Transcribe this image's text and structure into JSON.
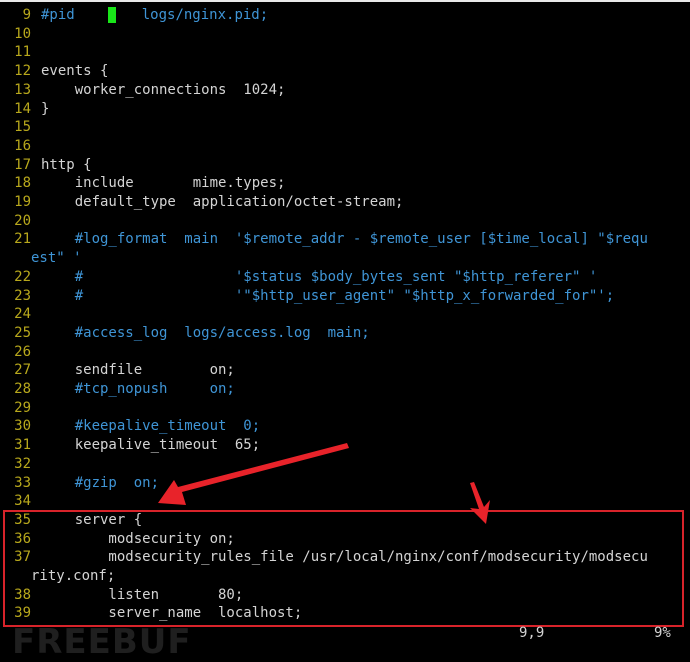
{
  "editor": {
    "rows": [
      {
        "num": "9",
        "segments": [
          {
            "t": "#pid    ",
            "c": "comment"
          },
          {
            "cursor": true
          },
          {
            "t": "   logs/nginx.pid;",
            "c": "comment"
          }
        ]
      },
      {
        "num": "10",
        "segments": []
      },
      {
        "num": "11",
        "segments": []
      },
      {
        "num": "12",
        "segments": [
          {
            "t": "events {"
          }
        ]
      },
      {
        "num": "13",
        "segments": [
          {
            "t": "    worker_connections  1024;"
          }
        ]
      },
      {
        "num": "14",
        "segments": [
          {
            "t": "}"
          }
        ]
      },
      {
        "num": "15",
        "segments": []
      },
      {
        "num": "16",
        "segments": []
      },
      {
        "num": "17",
        "segments": [
          {
            "t": "http {"
          }
        ]
      },
      {
        "num": "18",
        "segments": [
          {
            "t": "    include       mime.types;"
          }
        ]
      },
      {
        "num": "19",
        "segments": [
          {
            "t": "    default_type  application/octet-stream;"
          }
        ]
      },
      {
        "num": "20",
        "segments": []
      },
      {
        "num": "21",
        "segments": [
          {
            "t": "    #log_format  main  '$remote_addr - $remote_user [$time_local] \"$requ",
            "c": "comment"
          }
        ]
      },
      {
        "num": "",
        "wrap": true,
        "segments": [
          {
            "t": "est\" '",
            "c": "comment"
          }
        ]
      },
      {
        "num": "22",
        "segments": [
          {
            "t": "    #                  '$status $body_bytes_sent \"$http_referer\" '",
            "c": "comment"
          }
        ]
      },
      {
        "num": "23",
        "segments": [
          {
            "t": "    #                  '\"$http_user_agent\" \"$http_x_forwarded_for\"';",
            "c": "comment"
          }
        ]
      },
      {
        "num": "24",
        "segments": []
      },
      {
        "num": "25",
        "segments": [
          {
            "t": "    #access_log  logs/access.log  main;",
            "c": "comment"
          }
        ]
      },
      {
        "num": "26",
        "segments": []
      },
      {
        "num": "27",
        "segments": [
          {
            "t": "    sendfile        on;"
          }
        ]
      },
      {
        "num": "28",
        "segments": [
          {
            "t": "    #tcp_nopush     on;",
            "c": "comment"
          }
        ]
      },
      {
        "num": "29",
        "segments": []
      },
      {
        "num": "30",
        "segments": [
          {
            "t": "    #keepalive_timeout  0;",
            "c": "comment"
          }
        ]
      },
      {
        "num": "31",
        "segments": [
          {
            "t": "    keepalive_timeout  65;"
          }
        ]
      },
      {
        "num": "32",
        "segments": []
      },
      {
        "num": "33",
        "segments": [
          {
            "t": "    #gzip  on;",
            "c": "comment"
          }
        ]
      },
      {
        "num": "34",
        "segments": []
      },
      {
        "num": "35",
        "segments": [
          {
            "t": "    server {"
          }
        ]
      },
      {
        "num": "36",
        "segments": [
          {
            "t": "        modsecurity on;"
          }
        ]
      },
      {
        "num": "37",
        "segments": [
          {
            "t": "        modsecurity_rules_file /usr/local/nginx/conf/modsecurity/modsecu"
          }
        ]
      },
      {
        "num": "",
        "wrap": true,
        "segments": [
          {
            "t": "rity.conf;"
          }
        ]
      },
      {
        "num": "38",
        "segments": [
          {
            "t": "        listen       80;"
          }
        ]
      },
      {
        "num": "39",
        "segments": [
          {
            "t": "        server_name  localhost;"
          }
        ]
      }
    ]
  },
  "statusbar": {
    "position": "9,9",
    "percent": "9%"
  },
  "watermark": "FREEBUF",
  "colors": {
    "background": "#000000",
    "line_number": "#b8a81c",
    "comment": "#3f95d6",
    "text": "#d4d4d4",
    "cursor": "#19e619",
    "annotation": "#d8232a"
  }
}
